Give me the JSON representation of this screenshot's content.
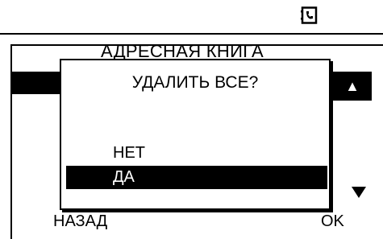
{
  "status_bar": {
    "icon": "address-book-icon"
  },
  "screen": {
    "title": "АДРЕСНАЯ КНИГА",
    "scroll_up_icon": "triangle-up-icon",
    "scroll_down_icon": "triangle-down-icon"
  },
  "dialog": {
    "question": "УДАЛИТЬ ВСЕ?",
    "options": [
      {
        "label": "НЕТ",
        "selected": false
      },
      {
        "label": "ДА",
        "selected": true
      }
    ]
  },
  "softkeys": {
    "left": "НАЗАД",
    "right": "OK"
  }
}
